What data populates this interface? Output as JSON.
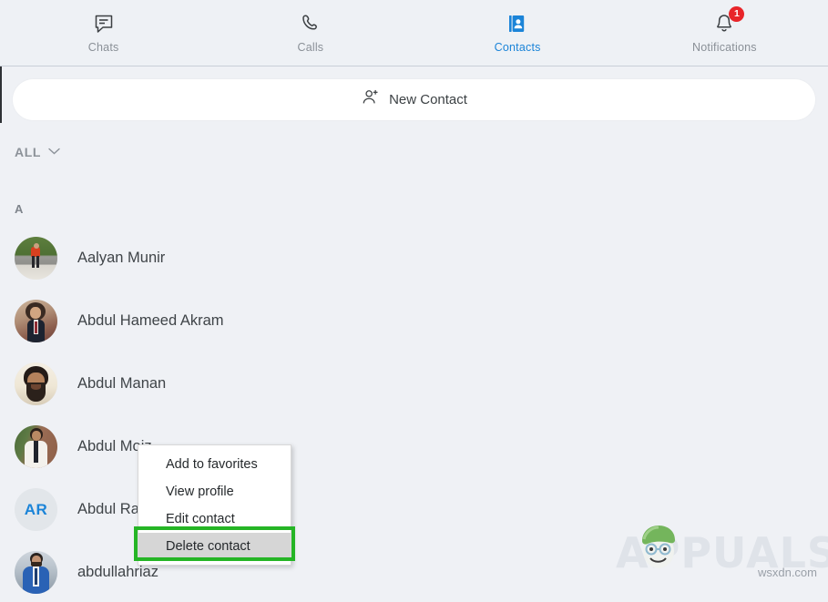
{
  "nav": {
    "items": [
      {
        "label": "Chats",
        "icon": "chat-bubble-icon",
        "active": false,
        "badge": null
      },
      {
        "label": "Calls",
        "icon": "phone-handset-icon",
        "active": false,
        "badge": null
      },
      {
        "label": "Contacts",
        "icon": "address-book-icon",
        "active": true,
        "badge": null
      },
      {
        "label": "Notifications",
        "icon": "bell-icon",
        "active": false,
        "badge": "1"
      }
    ],
    "active_color": "#1b84d8",
    "inactive_color": "#8a9097",
    "badge_color": "#e8252a"
  },
  "new_contact": {
    "label": "New Contact",
    "icon": "person-add-icon"
  },
  "filter": {
    "label": "ALL",
    "icon": "chevron-down-icon"
  },
  "list": {
    "section_letter": "A",
    "contacts": [
      {
        "name": "Aalyan Munir",
        "avatar_type": "photo"
      },
      {
        "name": "Abdul Hameed Akram",
        "avatar_type": "photo"
      },
      {
        "name": "Abdul Manan",
        "avatar_type": "photo"
      },
      {
        "name": "Abdul Moiz",
        "avatar_type": "photo"
      },
      {
        "name": "Abdul Ra",
        "avatar_type": "initials",
        "initials": "AR"
      },
      {
        "name": "abdullahriaz",
        "avatar_type": "photo"
      }
    ]
  },
  "context_menu": {
    "items": [
      {
        "label": "Add to favorites",
        "selected": false
      },
      {
        "label": "View profile",
        "selected": false
      },
      {
        "label": "Edit contact",
        "selected": false
      },
      {
        "label": "Delete contact",
        "selected": true
      }
    ],
    "highlight_color": "#25b525"
  },
  "watermark": {
    "brand": "APPUALS",
    "site": "wsxdn.com"
  }
}
